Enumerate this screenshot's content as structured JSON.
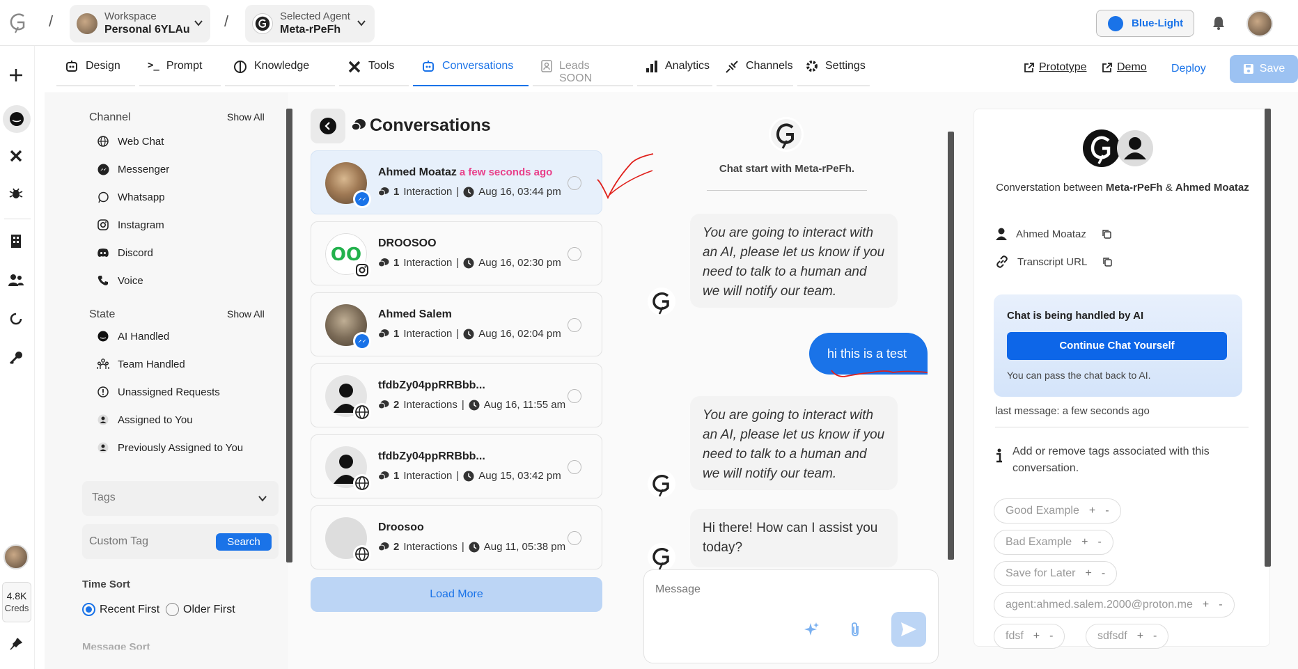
{
  "topbar": {
    "workspace_label": "Workspace",
    "workspace_name": "Personal 6YLAu",
    "agent_label": "Selected Agent",
    "agent_name": "Meta-rPeFh",
    "theme_label": "Blue-Light"
  },
  "tabs": [
    {
      "label": "Design"
    },
    {
      "label": "Prompt"
    },
    {
      "label": "Knowledge"
    },
    {
      "label": "Tools"
    },
    {
      "label": "Conversations"
    },
    {
      "label": "Leads SOON"
    },
    {
      "label": "Analytics"
    },
    {
      "label": "Channels"
    },
    {
      "label": "Settings"
    }
  ],
  "actions": {
    "prototype": "Prototype",
    "demo": "Demo",
    "deploy": "Deploy",
    "save": "Save"
  },
  "rail": {
    "creds_value": "4.8K",
    "creds_label": "Creds"
  },
  "filters": {
    "channel_title": "Channel",
    "channel_show_all": "Show All",
    "channels": [
      "Web Chat",
      "Messenger",
      "Whatsapp",
      "Instagram",
      "Discord",
      "Voice"
    ],
    "state_title": "State",
    "state_show_all": "Show All",
    "states": [
      "AI Handled",
      "Team Handled",
      "Unassigned Requests",
      "Assigned to You",
      "Previously Assigned to You"
    ],
    "tags_label": "Tags",
    "custom_tag_placeholder": "Custom Tag",
    "search_button": "Search",
    "time_sort_title": "Time Sort",
    "time_sort_options": [
      "Recent First",
      "Older First"
    ],
    "time_sort_selected": "Recent First",
    "message_sort_title": "Message Sort"
  },
  "conversations": {
    "title": "Conversations",
    "load_more": "Load More",
    "items": [
      {
        "name": "Ahmed Moataz",
        "ago": "a few seconds ago",
        "interactions": "1",
        "interaction_word": "Interaction",
        "date": "Aug 16, 03:44 pm",
        "channel": "messenger",
        "selected": true
      },
      {
        "name": "DROOSOO",
        "ago": "",
        "interactions": "1",
        "interaction_word": "Interaction",
        "date": "Aug 16, 02:30 pm",
        "channel": "instagram",
        "selected": false
      },
      {
        "name": "Ahmed Salem",
        "ago": "",
        "interactions": "1",
        "interaction_word": "Interaction",
        "date": "Aug 16, 02:04 pm",
        "channel": "messenger",
        "selected": false
      },
      {
        "name": "tfdbZy04ppRRBbb...",
        "ago": "",
        "interactions": "2",
        "interaction_word": "Interactions",
        "date": "Aug 16, 11:55 am",
        "channel": "web",
        "selected": false
      },
      {
        "name": "tfdbZy04ppRRBbb...",
        "ago": "",
        "interactions": "1",
        "interaction_word": "Interaction",
        "date": "Aug 15, 03:42 pm",
        "channel": "web",
        "selected": false
      },
      {
        "name": "Droosoo",
        "ago": "",
        "interactions": "2",
        "interaction_word": "Interactions",
        "date": "Aug 11, 05:38 pm",
        "channel": "web",
        "selected": false
      }
    ]
  },
  "chat": {
    "start_text": "Chat start with Meta-rPeFh.",
    "messages": [
      {
        "from": "bot",
        "text": "You are going to interact with an AI, please let us know if you need to talk to a human and we will notify our team."
      },
      {
        "from": "user",
        "text": "hi this is a test"
      },
      {
        "from": "bot",
        "text": "You are going to interact with an AI, please let us know if you need to talk to a human and we will notify our team."
      },
      {
        "from": "bot",
        "text": "Hi there! How can I assist you today?"
      }
    ],
    "input_placeholder": "Message"
  },
  "details": {
    "conv_prefix": "Converstation between",
    "agent": "Meta-rPeFh",
    "amp": "&",
    "user": "Ahmed Moataz",
    "user_label": "Ahmed Moataz",
    "transcript_label": "Transcript URL",
    "handled_title": "Chat is being handled by AI",
    "continue_button": "Continue Chat Yourself",
    "pass_back": "You can pass the chat back to AI.",
    "last_message": "last message: a few seconds ago",
    "tags_info": "Add or remove tags associated with this conversation.",
    "tags": [
      "Good Example",
      "Bad Example",
      "Save for Later",
      "agent:ahmed.salem.2000@proton.me",
      "fdsf",
      "sdfsdf"
    ],
    "plus": "+",
    "minus": "-"
  },
  "colors": {
    "accent": "#1a73e8",
    "user_bubble": "#1a73e8",
    "ago": "#e8408a",
    "annotation": "#e0201b"
  }
}
